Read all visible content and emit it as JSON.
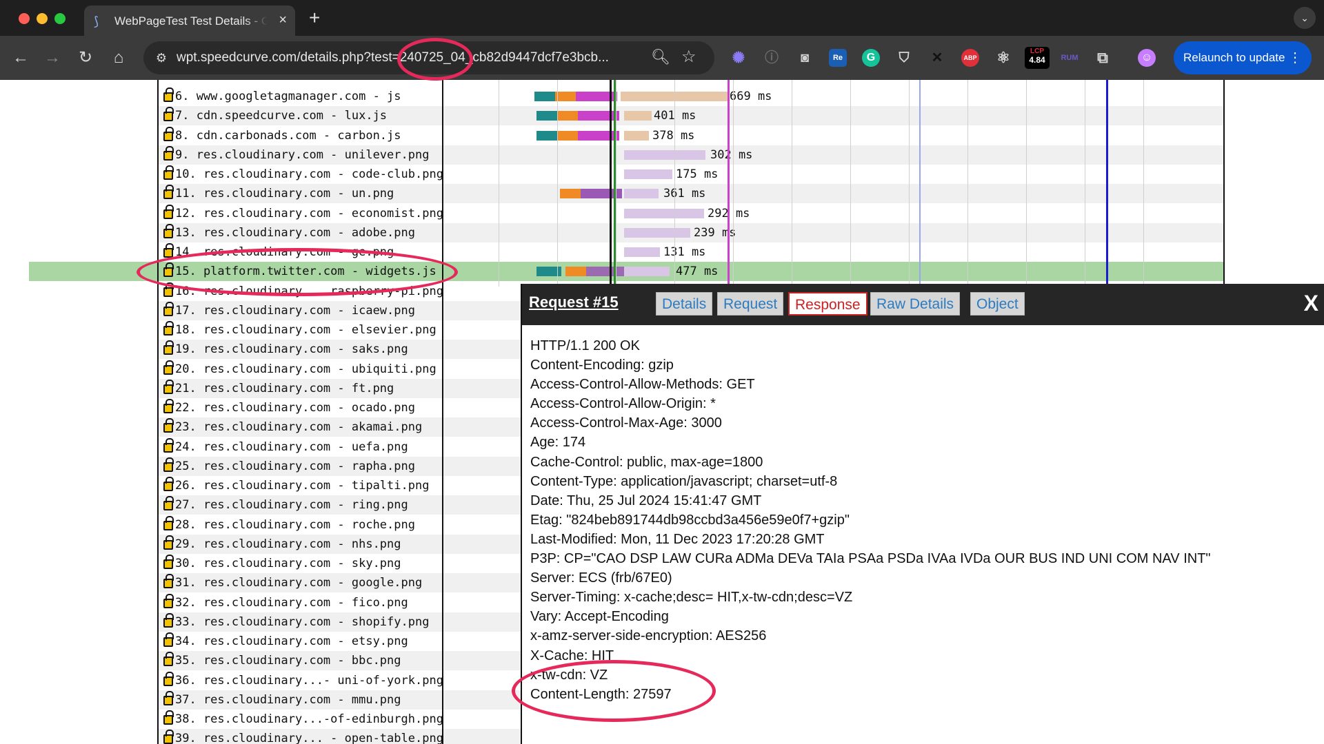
{
  "browser": {
    "tab_title": "WebPageTest Test Details - G",
    "tab_close": "×",
    "new_tab": "+",
    "url": "wpt.speedcurve.com/details.php?test=240725_04_cb82d9447dcf7e3bcb...",
    "relaunch_label": "Relaunch to update",
    "extensions": {
      "re": "Re",
      "abp": "ABP",
      "lcp_label": "LCP",
      "lcp_value": "4.84",
      "rum": "RUM"
    }
  },
  "requests": [
    {
      "label": " 6. www.googletagmanager.com - js",
      "ms": "669 ms"
    },
    {
      "label": " 7. cdn.speedcurve.com - lux.js",
      "ms": "401 ms"
    },
    {
      "label": " 8. cdn.carbonads.com - carbon.js",
      "ms": "378 ms"
    },
    {
      "label": " 9. res.cloudinary.com - unilever.png",
      "ms": "302 ms"
    },
    {
      "label": "10. res.cloudinary.com - code-club.png",
      "ms": "175 ms"
    },
    {
      "label": "11. res.cloudinary.com - un.png",
      "ms": "361 ms"
    },
    {
      "label": "12. res.cloudinary.com - economist.png",
      "ms": "292 ms"
    },
    {
      "label": "13. res.cloudinary.com - adobe.png",
      "ms": "239 ms"
    },
    {
      "label": "14. res.cloudinary.com - ge.png",
      "ms": "131 ms"
    },
    {
      "label": "15. platform.twitter.com - widgets.js",
      "ms": "477 ms"
    },
    {
      "label": "16. res.cloudinary... raspberry-pi.png",
      "ms": ""
    },
    {
      "label": "17. res.cloudinary.com - icaew.png",
      "ms": ""
    },
    {
      "label": "18. res.cloudinary.com - elsevier.png",
      "ms": ""
    },
    {
      "label": "19. res.cloudinary.com - saks.png",
      "ms": ""
    },
    {
      "label": "20. res.cloudinary.com - ubiquiti.png",
      "ms": ""
    },
    {
      "label": "21. res.cloudinary.com - ft.png",
      "ms": ""
    },
    {
      "label": "22. res.cloudinary.com - ocado.png",
      "ms": ""
    },
    {
      "label": "23. res.cloudinary.com - akamai.png",
      "ms": ""
    },
    {
      "label": "24. res.cloudinary.com - uefa.png",
      "ms": ""
    },
    {
      "label": "25. res.cloudinary.com - rapha.png",
      "ms": ""
    },
    {
      "label": "26. res.cloudinary.com - tipalti.png",
      "ms": ""
    },
    {
      "label": "27. res.cloudinary.com - ring.png",
      "ms": ""
    },
    {
      "label": "28. res.cloudinary.com - roche.png",
      "ms": ""
    },
    {
      "label": "29. res.cloudinary.com - nhs.png",
      "ms": ""
    },
    {
      "label": "30. res.cloudinary.com - sky.png",
      "ms": ""
    },
    {
      "label": "31. res.cloudinary.com - google.png",
      "ms": ""
    },
    {
      "label": "32. res.cloudinary.com - fico.png",
      "ms": ""
    },
    {
      "label": "33. res.cloudinary.com - shopify.png",
      "ms": ""
    },
    {
      "label": "34. res.cloudinary.com - etsy.png",
      "ms": ""
    },
    {
      "label": "35. res.cloudinary.com - bbc.png",
      "ms": ""
    },
    {
      "label": "36. res.cloudinary...- uni-of-york.png",
      "ms": ""
    },
    {
      "label": "37. res.cloudinary.com - mmu.png",
      "ms": ""
    },
    {
      "label": "38. res.cloudinary...-of-edinburgh.png",
      "ms": ""
    },
    {
      "label": "39. res.cloudinary... - open-table.png",
      "ms": ""
    }
  ],
  "overlay": {
    "title": "Request #15",
    "tabs": [
      "Details",
      "Request",
      "Response",
      "Raw Details",
      "Object"
    ],
    "active_tab": "Response",
    "close": "X",
    "headers": [
      "HTTP/1.1 200 OK",
      "Content-Encoding: gzip",
      "Access-Control-Allow-Methods: GET",
      "Access-Control-Allow-Origin: *",
      "Access-Control-Max-Age: 3000",
      "Age: 174",
      "Cache-Control: public, max-age=1800",
      "Content-Type: application/javascript; charset=utf-8",
      "Date: Thu, 25 Jul 2024 15:41:47 GMT",
      "Etag: \"824beb891744db98ccbd3a456e59e0f7+gzip\"",
      "Last-Modified: Mon, 11 Dec 2023 17:20:28 GMT",
      "P3P: CP=\"CAO DSP LAW CURa ADMa DEVa TAIa PSAa PSDa IVAa IVDa OUR BUS IND UNI COM NAV INT\"",
      "Server: ECS (frb/67E0)",
      "Server-Timing: x-cache;desc= HIT,x-tw-cdn;desc=VZ",
      "Vary: Accept-Encoding",
      "x-amz-server-side-encryption: AES256",
      "X-Cache: HIT",
      "x-tw-cdn: VZ",
      "Content-Length: 27597"
    ]
  },
  "colors": {
    "highlight_row": "#a9d6a3",
    "annotation": "#e5295a",
    "active_tab": "#cc2222",
    "tab_link": "#2c7bc0"
  }
}
